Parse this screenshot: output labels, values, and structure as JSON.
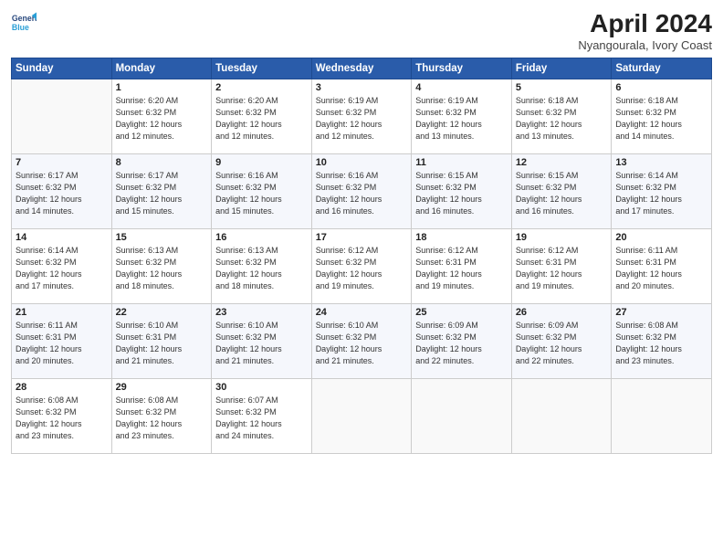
{
  "header": {
    "logo_line1": "General",
    "logo_line2": "Blue",
    "title": "April 2024",
    "subtitle": "Nyangourala, Ivory Coast"
  },
  "days_of_week": [
    "Sunday",
    "Monday",
    "Tuesday",
    "Wednesday",
    "Thursday",
    "Friday",
    "Saturday"
  ],
  "weeks": [
    [
      {
        "day": "",
        "detail": ""
      },
      {
        "day": "1",
        "detail": "Sunrise: 6:20 AM\nSunset: 6:32 PM\nDaylight: 12 hours\nand 12 minutes."
      },
      {
        "day": "2",
        "detail": "Sunrise: 6:20 AM\nSunset: 6:32 PM\nDaylight: 12 hours\nand 12 minutes."
      },
      {
        "day": "3",
        "detail": "Sunrise: 6:19 AM\nSunset: 6:32 PM\nDaylight: 12 hours\nand 12 minutes."
      },
      {
        "day": "4",
        "detail": "Sunrise: 6:19 AM\nSunset: 6:32 PM\nDaylight: 12 hours\nand 13 minutes."
      },
      {
        "day": "5",
        "detail": "Sunrise: 6:18 AM\nSunset: 6:32 PM\nDaylight: 12 hours\nand 13 minutes."
      },
      {
        "day": "6",
        "detail": "Sunrise: 6:18 AM\nSunset: 6:32 PM\nDaylight: 12 hours\nand 14 minutes."
      }
    ],
    [
      {
        "day": "7",
        "detail": "Sunrise: 6:17 AM\nSunset: 6:32 PM\nDaylight: 12 hours\nand 14 minutes."
      },
      {
        "day": "8",
        "detail": "Sunrise: 6:17 AM\nSunset: 6:32 PM\nDaylight: 12 hours\nand 15 minutes."
      },
      {
        "day": "9",
        "detail": "Sunrise: 6:16 AM\nSunset: 6:32 PM\nDaylight: 12 hours\nand 15 minutes."
      },
      {
        "day": "10",
        "detail": "Sunrise: 6:16 AM\nSunset: 6:32 PM\nDaylight: 12 hours\nand 16 minutes."
      },
      {
        "day": "11",
        "detail": "Sunrise: 6:15 AM\nSunset: 6:32 PM\nDaylight: 12 hours\nand 16 minutes."
      },
      {
        "day": "12",
        "detail": "Sunrise: 6:15 AM\nSunset: 6:32 PM\nDaylight: 12 hours\nand 16 minutes."
      },
      {
        "day": "13",
        "detail": "Sunrise: 6:14 AM\nSunset: 6:32 PM\nDaylight: 12 hours\nand 17 minutes."
      }
    ],
    [
      {
        "day": "14",
        "detail": "Sunrise: 6:14 AM\nSunset: 6:32 PM\nDaylight: 12 hours\nand 17 minutes."
      },
      {
        "day": "15",
        "detail": "Sunrise: 6:13 AM\nSunset: 6:32 PM\nDaylight: 12 hours\nand 18 minutes."
      },
      {
        "day": "16",
        "detail": "Sunrise: 6:13 AM\nSunset: 6:32 PM\nDaylight: 12 hours\nand 18 minutes."
      },
      {
        "day": "17",
        "detail": "Sunrise: 6:12 AM\nSunset: 6:32 PM\nDaylight: 12 hours\nand 19 minutes."
      },
      {
        "day": "18",
        "detail": "Sunrise: 6:12 AM\nSunset: 6:31 PM\nDaylight: 12 hours\nand 19 minutes."
      },
      {
        "day": "19",
        "detail": "Sunrise: 6:12 AM\nSunset: 6:31 PM\nDaylight: 12 hours\nand 19 minutes."
      },
      {
        "day": "20",
        "detail": "Sunrise: 6:11 AM\nSunset: 6:31 PM\nDaylight: 12 hours\nand 20 minutes."
      }
    ],
    [
      {
        "day": "21",
        "detail": "Sunrise: 6:11 AM\nSunset: 6:31 PM\nDaylight: 12 hours\nand 20 minutes."
      },
      {
        "day": "22",
        "detail": "Sunrise: 6:10 AM\nSunset: 6:31 PM\nDaylight: 12 hours\nand 21 minutes."
      },
      {
        "day": "23",
        "detail": "Sunrise: 6:10 AM\nSunset: 6:32 PM\nDaylight: 12 hours\nand 21 minutes."
      },
      {
        "day": "24",
        "detail": "Sunrise: 6:10 AM\nSunset: 6:32 PM\nDaylight: 12 hours\nand 21 minutes."
      },
      {
        "day": "25",
        "detail": "Sunrise: 6:09 AM\nSunset: 6:32 PM\nDaylight: 12 hours\nand 22 minutes."
      },
      {
        "day": "26",
        "detail": "Sunrise: 6:09 AM\nSunset: 6:32 PM\nDaylight: 12 hours\nand 22 minutes."
      },
      {
        "day": "27",
        "detail": "Sunrise: 6:08 AM\nSunset: 6:32 PM\nDaylight: 12 hours\nand 23 minutes."
      }
    ],
    [
      {
        "day": "28",
        "detail": "Sunrise: 6:08 AM\nSunset: 6:32 PM\nDaylight: 12 hours\nand 23 minutes."
      },
      {
        "day": "29",
        "detail": "Sunrise: 6:08 AM\nSunset: 6:32 PM\nDaylight: 12 hours\nand 23 minutes."
      },
      {
        "day": "30",
        "detail": "Sunrise: 6:07 AM\nSunset: 6:32 PM\nDaylight: 12 hours\nand 24 minutes."
      },
      {
        "day": "",
        "detail": ""
      },
      {
        "day": "",
        "detail": ""
      },
      {
        "day": "",
        "detail": ""
      },
      {
        "day": "",
        "detail": ""
      }
    ]
  ]
}
